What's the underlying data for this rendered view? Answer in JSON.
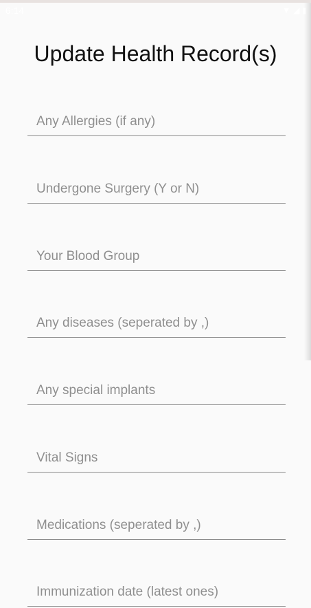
{
  "status_bar": {
    "time": "6:14",
    "icons": [
      "wifi-icon",
      "signal-icon",
      "battery-icon"
    ]
  },
  "header": {
    "title": "Update Health Record(s)"
  },
  "form": {
    "fields": [
      {
        "placeholder": "Any Allergies (if any)",
        "value": ""
      },
      {
        "placeholder": "Undergone Surgery (Y or N)",
        "value": ""
      },
      {
        "placeholder": "Your Blood Group",
        "value": ""
      },
      {
        "placeholder": "Any diseases (seperated by ,)",
        "value": ""
      },
      {
        "placeholder": "Any special implants",
        "value": ""
      },
      {
        "placeholder": "Vital Signs",
        "value": ""
      },
      {
        "placeholder": "Medications (seperated by ,)",
        "value": ""
      },
      {
        "placeholder": "Immunization date (latest ones)",
        "value": ""
      }
    ]
  },
  "colors": {
    "background": "#fafafa",
    "title": "#111111",
    "placeholder": "#8f8f8f",
    "underline": "#8a8a8a"
  }
}
